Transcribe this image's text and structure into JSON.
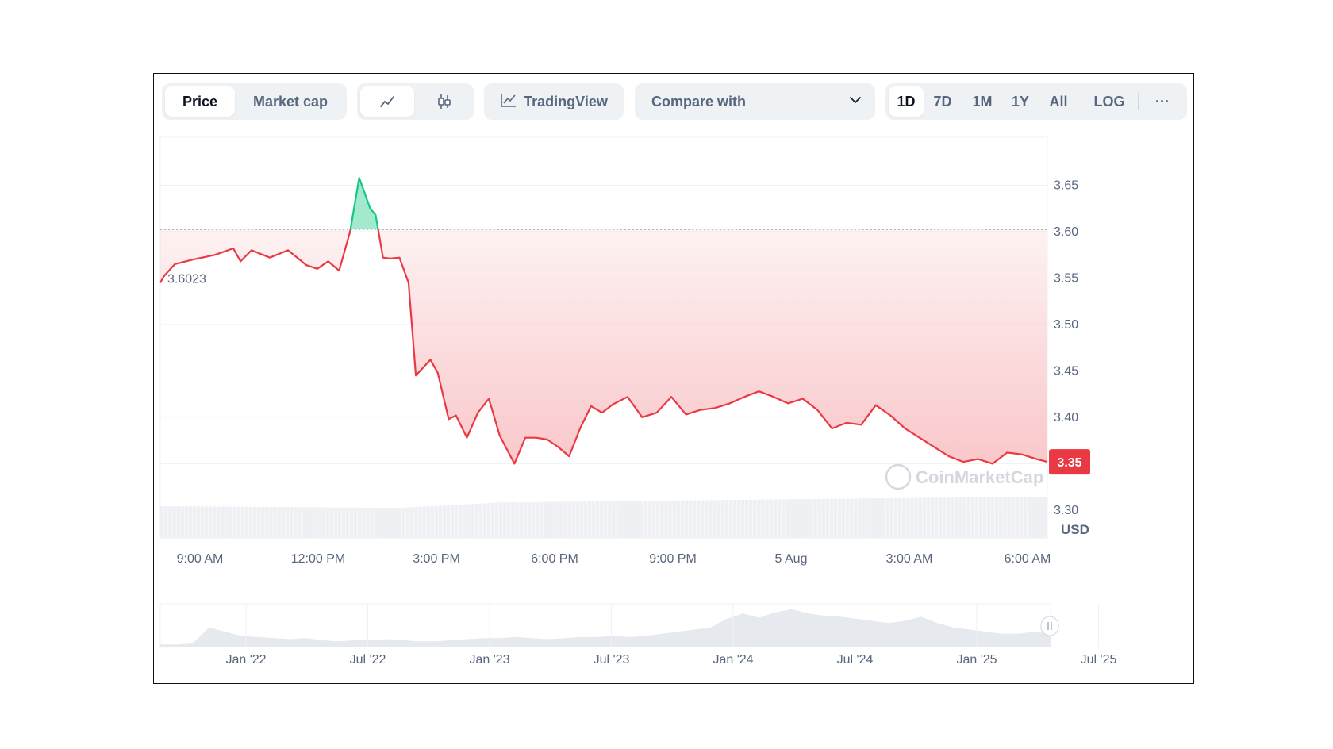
{
  "toolbar": {
    "price_tabs": [
      "Price",
      "Market cap"
    ],
    "active_price_tab": "Price",
    "chart_type_icons": [
      "line-chart-icon",
      "candlestick-icon"
    ],
    "tradingview_label": "TradingView",
    "compare_label": "Compare with",
    "ranges": [
      "1D",
      "7D",
      "1M",
      "1Y",
      "All"
    ],
    "active_range": "1D",
    "log_label": "LOG",
    "more_label": "···"
  },
  "colors": {
    "down": "#ea3943",
    "up": "#16c784",
    "grid": "#eff2f5",
    "axis_text": "#58667e"
  },
  "watermark": "CoinMarketCap",
  "chart_data": {
    "type": "line",
    "title": "",
    "ylabel": "USD",
    "xlabel": "",
    "ylim": [
      3.27,
      3.7
    ],
    "y_ticks": [
      "3.65",
      "3.60",
      "3.55",
      "3.50",
      "3.45",
      "3.40",
      "3.30"
    ],
    "x_ticks": [
      "9:00 AM",
      "12:00 PM",
      "3:00 PM",
      "6:00 PM",
      "9:00 PM",
      "5 Aug",
      "3:00 AM",
      "6:00 AM"
    ],
    "baseline": 3.6023,
    "baseline_label": "3.6023",
    "current_price_label": "3.35",
    "x_hours": [
      0,
      0.1,
      0.4,
      0.9,
      1.5,
      2.0,
      2.2,
      2.5,
      3.0,
      3.5,
      4.0,
      4.3,
      4.6,
      4.9,
      5.2,
      5.45,
      5.75,
      5.9,
      6.1,
      6.3,
      6.55,
      6.8,
      7.0,
      7.4,
      7.6,
      7.9,
      8.1,
      8.4,
      8.7,
      9.0,
      9.3,
      9.7,
      10.0,
      10.3,
      10.6,
      10.9,
      11.2,
      11.5,
      11.8,
      12.1,
      12.4,
      12.8,
      13.2,
      13.6,
      14.0,
      14.4,
      14.8,
      15.2,
      15.6,
      16.0,
      16.4,
      16.8,
      17.2,
      17.6,
      18.0,
      18.4,
      18.8,
      19.2,
      19.6,
      20.0,
      20.4,
      20.8,
      21.2,
      21.6,
      22.0,
      22.4,
      22.8,
      23.2,
      23.6,
      24.0,
      24.3
    ],
    "values": [
      3.545,
      3.552,
      3.565,
      3.57,
      3.575,
      3.582,
      3.568,
      3.58,
      3.572,
      3.58,
      3.564,
      3.56,
      3.568,
      3.558,
      3.6,
      3.658,
      3.625,
      3.618,
      3.572,
      3.571,
      3.572,
      3.545,
      3.445,
      3.462,
      3.448,
      3.398,
      3.402,
      3.378,
      3.405,
      3.42,
      3.38,
      3.35,
      3.378,
      3.378,
      3.376,
      3.368,
      3.358,
      3.388,
      3.412,
      3.405,
      3.414,
      3.422,
      3.4,
      3.405,
      3.422,
      3.403,
      3.408,
      3.41,
      3.415,
      3.422,
      3.428,
      3.422,
      3.415,
      3.42,
      3.408,
      3.388,
      3.394,
      3.392,
      3.413,
      3.402,
      3.388,
      3.378,
      3.368,
      3.358,
      3.352,
      3.355,
      3.35,
      3.362,
      3.36,
      3.355,
      3.352
    ],
    "navigator": {
      "x_ticks": [
        "Jan '22",
        "Jul '22",
        "Jan '23",
        "Jul '23",
        "Jan '24",
        "Jul '24",
        "Jan '25",
        "Jul '25"
      ],
      "values": [
        2,
        2,
        3,
        18,
        14,
        10,
        9,
        8,
        7,
        8,
        6,
        5,
        6,
        6,
        7,
        6,
        5,
        5,
        6,
        7,
        8,
        8,
        9,
        8,
        7,
        8,
        9,
        9,
        10,
        9,
        10,
        12,
        14,
        16,
        18,
        26,
        31,
        27,
        32,
        35,
        31,
        29,
        28,
        26,
        24,
        22,
        24,
        28,
        22,
        18,
        16,
        14,
        12,
        12,
        14,
        12
      ]
    }
  }
}
